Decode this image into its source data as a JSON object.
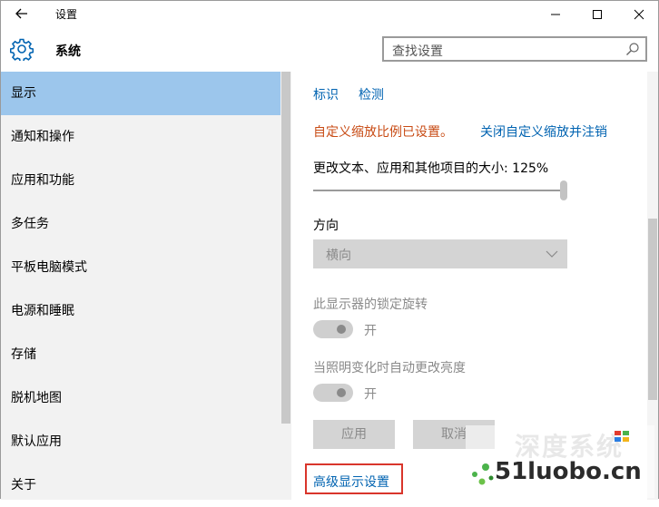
{
  "window": {
    "title": "设置"
  },
  "header": {
    "section_title": "系统",
    "search_placeholder": "查找设置"
  },
  "sidebar": {
    "items": [
      {
        "label": "显示",
        "active": true
      },
      {
        "label": "通知和操作"
      },
      {
        "label": "应用和功能"
      },
      {
        "label": "多任务"
      },
      {
        "label": "平板电脑模式"
      },
      {
        "label": "电源和睡眠"
      },
      {
        "label": "存储"
      },
      {
        "label": "脱机地图"
      },
      {
        "label": "默认应用"
      },
      {
        "label": "关于"
      }
    ]
  },
  "main": {
    "identify_link": "标识",
    "detect_link": "检测",
    "custom_scale_warning": "自定义缩放比例已设置。",
    "disable_custom_scale_link": "关闭自定义缩放并注销",
    "scale_label": "更改文本、应用和其他项目的大小: 125%",
    "scale_value_percent": 125,
    "orientation_label": "方向",
    "orientation_value": "横向",
    "rotation_lock_label": "此显示器的锁定旋转",
    "rotation_lock_state": "开",
    "auto_brightness_label": "当照明变化时自动更改亮度",
    "auto_brightness_state": "开",
    "apply_button": "应用",
    "cancel_button": "取消",
    "advanced_link": "高级显示设置"
  },
  "watermark": {
    "brand_top": "深度系统",
    "brand_url": "51luobo.cn"
  },
  "colors": {
    "accent": "#0063b1",
    "sidebar_active": "#9cc6ec",
    "sidebar_bg": "#f2f2f2",
    "warning": "#c84b14",
    "highlight_box": "#d9352b"
  }
}
